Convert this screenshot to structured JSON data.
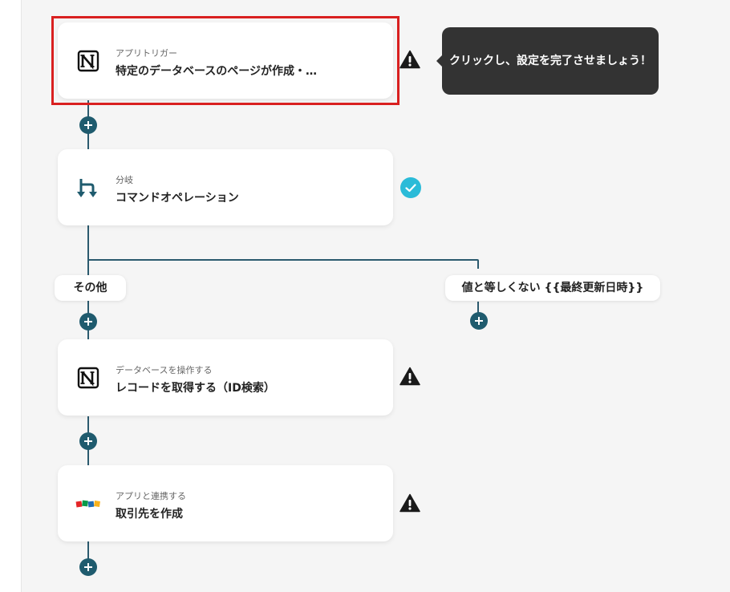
{
  "steps": [
    {
      "sub": "アプリトリガー",
      "title": "特定のデータベースのページが作成・…",
      "icon": "notion-icon",
      "status": "warning"
    },
    {
      "sub": "分岐",
      "title": "コマンドオペレーション",
      "icon": "branch-icon",
      "status": "complete"
    },
    {
      "sub": "データベースを操作する",
      "title": "レコードを取得する（ID検索）",
      "icon": "notion-icon",
      "status": "warning"
    },
    {
      "sub": "アプリと連携する",
      "title": "取引先を作成",
      "icon": "zoho-icon",
      "status": "warning"
    }
  ],
  "branches": {
    "left": "その他",
    "right": "値と等しくない {{最終更新日時}}"
  },
  "tooltip": "クリックし、設定を完了させましょう！",
  "colors": {
    "line": "#2b5a6e",
    "plus": "#1f5b6e",
    "highlight": "#d92020",
    "check": "#2bbbd8",
    "tooltip_bg": "#333333"
  }
}
